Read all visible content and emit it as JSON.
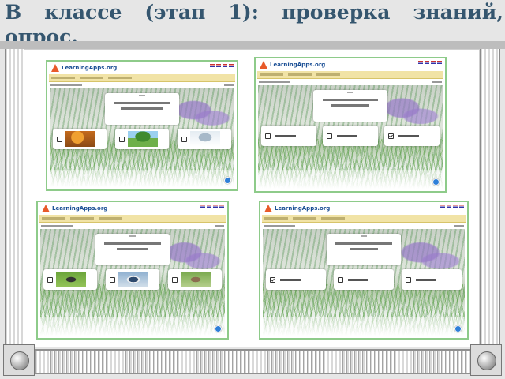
{
  "slide": {
    "title_line1": "В классе (этап 1): проверка знаний,",
    "title_line2": "опрос."
  },
  "screenshots": [
    {
      "logo_text": "LearningApps.org",
      "answer_thumbs": [
        "autumn",
        "summer",
        "winter"
      ],
      "checked": [
        false,
        false,
        false
      ]
    },
    {
      "logo_text": "LearningApps.org",
      "answer_thumbs": [
        "text",
        "text",
        "text"
      ],
      "checked": [
        false,
        false,
        true
      ]
    },
    {
      "logo_text": "LearningApps.org",
      "answer_thumbs": [
        "bird-1",
        "bird-2",
        "bird-3"
      ],
      "checked": [
        false,
        false,
        false
      ]
    },
    {
      "logo_text": "LearningApps.org",
      "answer_thumbs": [
        "text",
        "text",
        "text"
      ],
      "checked": [
        true,
        false,
        false
      ]
    }
  ],
  "icons": {
    "logo": "learningapps-logo-icon",
    "check": "check-answer-icon",
    "scroll_knob": "scroll-knob-icon"
  },
  "colors": {
    "title": "#35566f",
    "frame_border": "#8ecb8a",
    "navbar": "#f1e3a6",
    "check_button": "#2f7fd8"
  }
}
